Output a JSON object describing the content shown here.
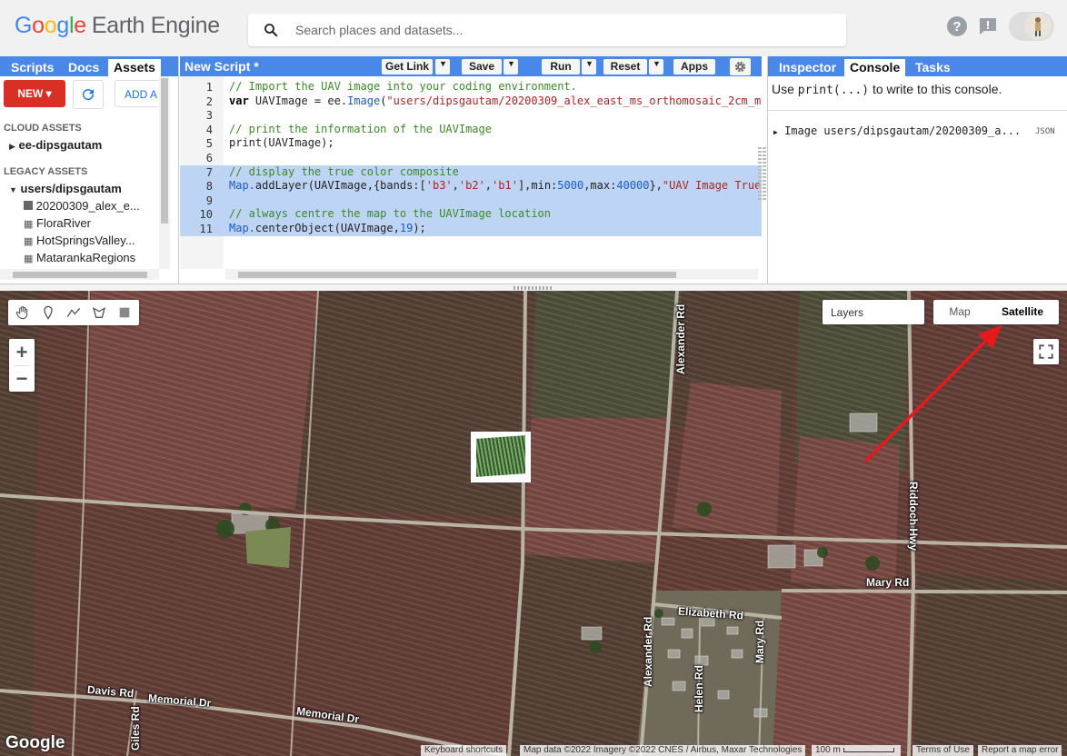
{
  "header": {
    "logo_google": "Google",
    "logo_product": "Earth Engine",
    "search_placeholder": "Search places and datasets..."
  },
  "left_panel": {
    "tabs": [
      "Scripts",
      "Docs",
      "Assets"
    ],
    "active_tab": "Assets",
    "new_button": "NEW",
    "add_button": "ADD A",
    "cloud_assets_label": "CLOUD ASSETS",
    "cloud_project": "ee-dipsgautam",
    "legacy_assets_label": "LEGACY ASSETS",
    "legacy_folder": "users/dipsgautam",
    "legacy_items": [
      "20200309_alex_e...",
      "FloraRiver",
      "HotSpringsValley...",
      "MatarankaRegions"
    ]
  },
  "editor": {
    "title": "New Script *",
    "buttons": {
      "get_link": "Get Link",
      "save": "Save",
      "run": "Run",
      "reset": "Reset",
      "apps": "Apps"
    },
    "line_numbers": [
      "1",
      "2",
      "3",
      "4",
      "5",
      "6",
      "7",
      "8",
      "9",
      "10",
      "11"
    ],
    "lines": [
      [
        {
          "t": "// Import the UAV image into your coding environment.",
          "c": "cm"
        }
      ],
      [
        {
          "t": "var",
          "c": "kw"
        },
        {
          "t": " UAVImage = ee.",
          "c": ""
        },
        {
          "t": "Image",
          "c": "nm"
        },
        {
          "t": "(",
          "c": ""
        },
        {
          "t": "\"users/dipsgautam/20200309_alex_east_ms_orthomosaic_2cm_m",
          "c": "st"
        }
      ],
      [],
      [
        {
          "t": "// print the information of the UAVImage",
          "c": "cm"
        }
      ],
      [
        {
          "t": "print(UAVImage);",
          "c": ""
        }
      ],
      [],
      [
        {
          "t": "// display the true color composite",
          "c": "cm"
        }
      ],
      [
        {
          "t": "Map.",
          "c": "nm"
        },
        {
          "t": "addLayer(UAVImage,{bands:[",
          "c": ""
        },
        {
          "t": "'b3'",
          "c": "st"
        },
        {
          "t": ",",
          "c": ""
        },
        {
          "t": "'b2'",
          "c": "st"
        },
        {
          "t": ",",
          "c": ""
        },
        {
          "t": "'b1'",
          "c": "st"
        },
        {
          "t": "],min:",
          "c": ""
        },
        {
          "t": "5000",
          "c": "nm"
        },
        {
          "t": ",max:",
          "c": ""
        },
        {
          "t": "40000",
          "c": "nm"
        },
        {
          "t": "},",
          "c": ""
        },
        {
          "t": "\"UAV Image True",
          "c": "st"
        }
      ],
      [],
      [
        {
          "t": "// always centre the map to the UAVImage location",
          "c": "cm"
        }
      ],
      [
        {
          "t": "Map.",
          "c": "nm"
        },
        {
          "t": "centerObject(UAVImage,",
          "c": ""
        },
        {
          "t": "19",
          "c": "nm"
        },
        {
          "t": ");",
          "c": ""
        }
      ]
    ],
    "highlighted_lines": [
      7,
      8,
      9,
      10,
      11
    ]
  },
  "right_panel": {
    "tabs": [
      "Inspector",
      "Console",
      "Tasks"
    ],
    "active_tab": "Console",
    "hint_prefix": "Use ",
    "hint_code": "print(...)",
    "hint_suffix": " to write to this console.",
    "output_item": "Image users/dipsgautam/20200309_a...",
    "output_format": "JSON"
  },
  "map": {
    "layers_label": "Layers",
    "map_type_options": [
      "Map",
      "Satellite"
    ],
    "selected_map_type": "Satellite",
    "zoom_in": "+",
    "zoom_out": "−",
    "road_labels": {
      "alexander_rd_top": "Alexander Rd",
      "riddoch_hwy": "Riddoch Hwy",
      "mary_rd": "Mary Rd",
      "elizabeth_rd": "Elizabeth Rd",
      "alexander_rd_bottom": "Alexander Rd",
      "helen_rd": "Helen Rd",
      "mary_rd_vertical": "Mary Rd",
      "davis_rd": "Davis Rd",
      "memorial_dr_1": "Memorial Dr",
      "memorial_dr_2": "Memorial Dr",
      "giles_rd": "Giles Rd"
    },
    "google_logo": "Google",
    "footer": {
      "shortcuts": "Keyboard shortcuts",
      "attribution": "Map data ©2022 Imagery ©2022 CNES / Airbus, Maxar Technologies",
      "scale": "100 m",
      "terms": "Terms of Use",
      "report": "Report a map error"
    }
  },
  "colors": {
    "panel_tab_blue": "#4a88e8",
    "new_button_red": "#d93025",
    "selection_highlight": "#bdd4f5",
    "annotation_arrow": "#e8191a"
  }
}
